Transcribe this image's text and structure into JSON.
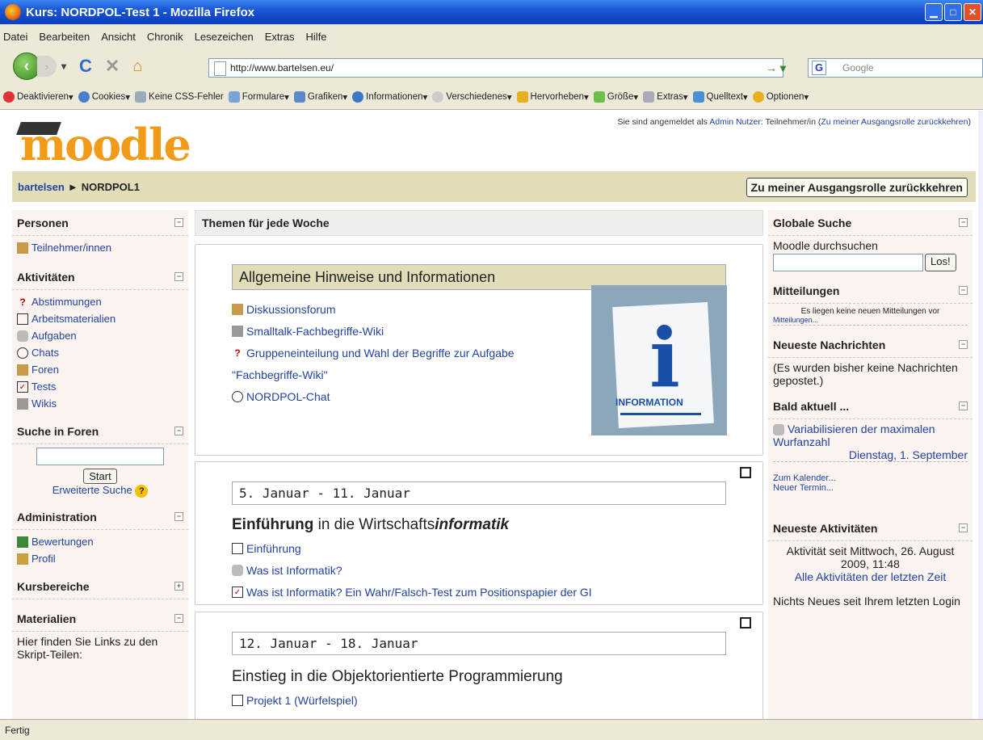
{
  "window": {
    "title": "Kurs: NORDPOL-Test 1 - Mozilla Firefox"
  },
  "menu": [
    "Datei",
    "Bearbeiten",
    "Ansicht",
    "Chronik",
    "Lesezeichen",
    "Extras",
    "Hilfe"
  ],
  "address": {
    "url": "http://www.bartelsen.eu/",
    "search_placeholder": "Google"
  },
  "devtoolbar": [
    "Deaktivieren",
    "Cookies",
    "Keine CSS-Fehler",
    "Formulare",
    "Grafiken",
    "Informationen",
    "Verschiedenes",
    "Hervorheben",
    "Größe",
    "Extras",
    "Quelltext",
    "Optionen"
  ],
  "header": {
    "logo": "moodle",
    "login_prefix": "Sie sind angemeldet als ",
    "login_user": "Admin Nutzer",
    "login_role": ": Teilnehmer/in (",
    "login_link": "Zu meiner Ausgangsrolle zurückkehren",
    "login_suffix": ")",
    "bread_home": "bartelsen",
    "bread_arrow": "►",
    "bread_course": "NORDPOL1",
    "role_button": "Zu meiner Ausgangsrolle zurückkehren"
  },
  "left": {
    "personen": {
      "title": "Personen",
      "toggle": "−",
      "items": [
        "Teilnehmer/innen"
      ]
    },
    "aktivitaeten": {
      "title": "Aktivitäten",
      "toggle": "−",
      "items": [
        "Abstimmungen",
        "Arbeitsmaterialien",
        "Aufgaben",
        "Chats",
        "Foren",
        "Tests",
        "Wikis"
      ]
    },
    "suche": {
      "title": "Suche in Foren",
      "toggle": "−",
      "button": "Start",
      "advanced": "Erweiterte Suche",
      "help": "?"
    },
    "admin": {
      "title": "Administration",
      "toggle": "−",
      "items": [
        "Bewertungen",
        "Profil"
      ]
    },
    "kurs": {
      "title": "Kursbereiche",
      "toggle": "+"
    },
    "material": {
      "title": "Materialien",
      "toggle": "−",
      "text": "Hier finden Sie Links zu den Skript-Teilen:"
    }
  },
  "center": {
    "heading": "Themen für jede Woche",
    "general": {
      "title": "Allgemeine Hinweise und Informationen",
      "items": [
        "Diskussionsforum",
        "Smalltalk-Fachbegriffe-Wiki",
        "Gruppeneinteilung und Wahl der Begriffe zur Aufgabe",
        "\"Fachbegriffe-Wiki\"",
        "NORDPOL-Chat"
      ],
      "image_text": "INFORMATION",
      "image_letter": "i"
    },
    "week1": {
      "date": "5. Januar - 11. Januar",
      "title_bold": "Einführung",
      "title_mid": " in die Wirtschafts",
      "title_ital": "informatik",
      "items": [
        "Einführung",
        "Was ist Informatik?",
        "Was ist Informatik? Ein Wahr/Falsch-Test zum Positionspapier der GI"
      ]
    },
    "week2": {
      "date": "12. Januar - 18. Januar",
      "title": "Einstieg in die Objektorientierte Programmierung",
      "items": [
        "Projekt 1 (Würfelspiel)"
      ]
    }
  },
  "right": {
    "suche": {
      "title": "Globale Suche",
      "toggle": "−",
      "label": "Moodle durchsuchen",
      "button": "Los!"
    },
    "mitteilungen": {
      "title": "Mitteilungen",
      "toggle": "−",
      "text": "Es liegen keine neuen Mitteilungen vor",
      "link": "Mitteilungen..."
    },
    "nachrichten": {
      "title": "Neueste Nachrichten",
      "toggle": "−",
      "text": "(Es wurden bisher keine Nachrichten gepostet.)"
    },
    "bald": {
      "title": "Bald aktuell ...",
      "toggle": "−",
      "event": "Variabilisieren der maximalen Wurfanzahl",
      "date": "Dienstag, 1. September",
      "cal": "Zum Kalender...",
      "new": "Neuer Termin..."
    },
    "aktiv": {
      "title": "Neueste Aktivitäten",
      "toggle": "−",
      "since": "Aktivität seit Mittwoch, 26. August 2009, 11:48",
      "all": "Alle Aktivitäten der letzten Zeit",
      "none": "Nichts Neues seit Ihrem letzten Login"
    }
  },
  "status": "Fertig"
}
